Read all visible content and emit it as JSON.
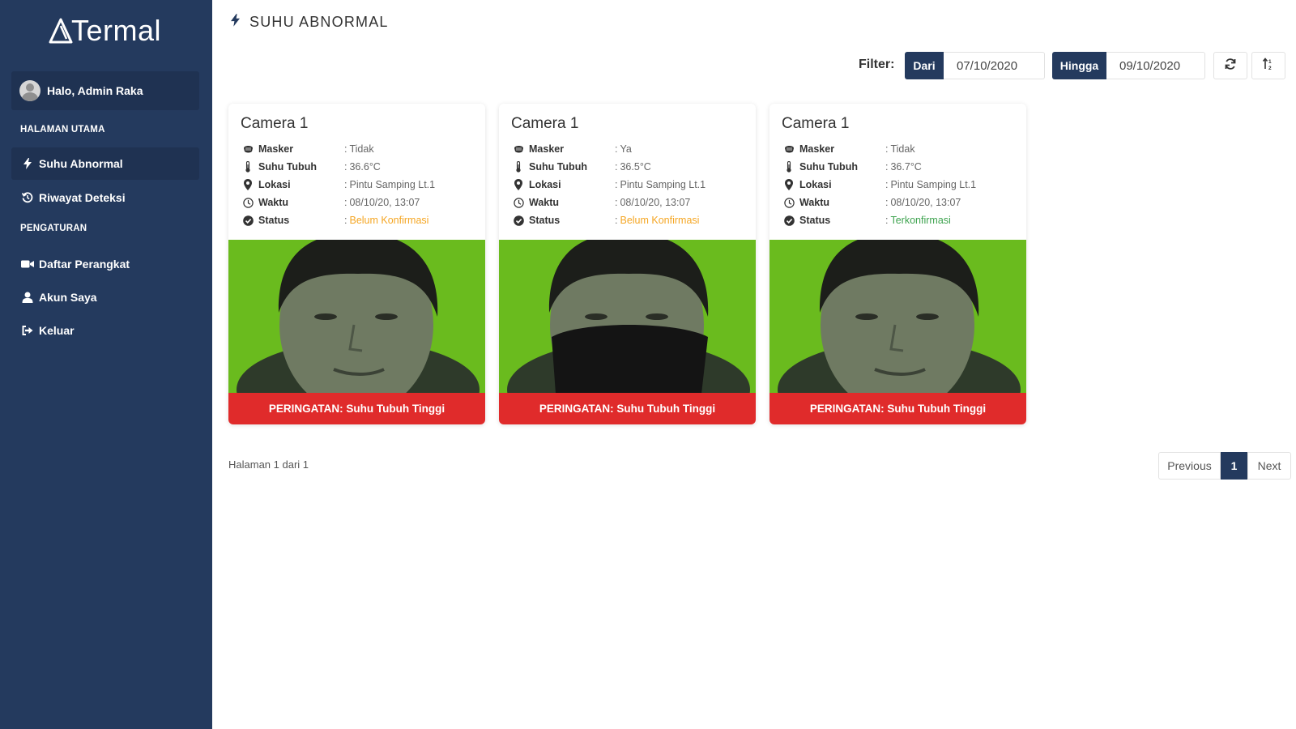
{
  "sidebar": {
    "logo": "Termal",
    "user_greeting": "Halo, Admin Raka",
    "section_main": "HALAMAN UTAMA",
    "section_settings": "PENGATURAN",
    "items": [
      {
        "label": "Suhu Abnormal",
        "icon": "bolt-icon",
        "active": true
      },
      {
        "label": "Riwayat Deteksi",
        "icon": "history-icon",
        "active": false
      },
      {
        "label": "Daftar Perangkat",
        "icon": "video-camera-icon",
        "active": false
      },
      {
        "label": "Akun Saya",
        "icon": "user-icon",
        "active": false
      },
      {
        "label": "Keluar",
        "icon": "sign-out-icon",
        "active": false
      }
    ]
  },
  "header": {
    "title": "SUHU ABNORMAL",
    "title_icon": "bolt-icon"
  },
  "filter": {
    "label": "Filter:",
    "from_label": "Dari",
    "from_value": "07/10/2020",
    "to_label": "Hingga",
    "to_value": "09/10/2020",
    "refresh_icon": "refresh-icon",
    "sort_icon": "sort-icon"
  },
  "cards": [
    {
      "title": "Camera 1",
      "rows": [
        {
          "icon": "mask-icon",
          "label": "Masker",
          "value": "Tidak"
        },
        {
          "icon": "thermometer-icon",
          "label": "Suhu Tubuh",
          "value": "36.6°C"
        },
        {
          "icon": "map-marker-icon",
          "label": "Lokasi",
          "value": "Pintu Samping Lt.1"
        },
        {
          "icon": "clock-icon",
          "label": "Waktu",
          "value": "08/10/20, 13:07"
        },
        {
          "icon": "check-circle-icon",
          "label": "Status",
          "value": "Belum Konfirmasi",
          "color": "#f5a623"
        }
      ],
      "warning": "PERINGATAN: Suhu Tubuh Tinggi"
    },
    {
      "title": "Camera 1",
      "rows": [
        {
          "icon": "mask-icon",
          "label": "Masker",
          "value": "Ya"
        },
        {
          "icon": "thermometer-icon",
          "label": "Suhu Tubuh",
          "value": "36.5°C"
        },
        {
          "icon": "map-marker-icon",
          "label": "Lokasi",
          "value": "Pintu Samping Lt.1"
        },
        {
          "icon": "clock-icon",
          "label": "Waktu",
          "value": "08/10/20, 13:07"
        },
        {
          "icon": "check-circle-icon",
          "label": "Status",
          "value": "Belum Konfirmasi",
          "color": "#f5a623"
        }
      ],
      "warning": "PERINGATAN: Suhu Tubuh Tinggi"
    },
    {
      "title": "Camera 1",
      "rows": [
        {
          "icon": "mask-icon",
          "label": "Masker",
          "value": "Tidak"
        },
        {
          "icon": "thermometer-icon",
          "label": "Suhu Tubuh",
          "value": "36.7°C"
        },
        {
          "icon": "map-marker-icon",
          "label": "Lokasi",
          "value": "Pintu Samping Lt.1"
        },
        {
          "icon": "clock-icon",
          "label": "Waktu",
          "value": "08/10/20, 13:07"
        },
        {
          "icon": "check-circle-icon",
          "label": "Status",
          "value": "Terkonfirmasi",
          "color": "#3ea34f"
        }
      ],
      "warning": "PERINGATAN: Suhu Tubuh Tinggi"
    }
  ],
  "pagination": {
    "info": "Halaman 1 dari 1",
    "previous": "Previous",
    "current": "1",
    "next": "Next"
  },
  "colors": {
    "sidebar_bg": "#243a5e",
    "accent": "#243a5e",
    "warning": "#e02b2b",
    "pending": "#f5a623",
    "confirmed": "#3ea34f",
    "photo_bg": "#6fc21f"
  }
}
